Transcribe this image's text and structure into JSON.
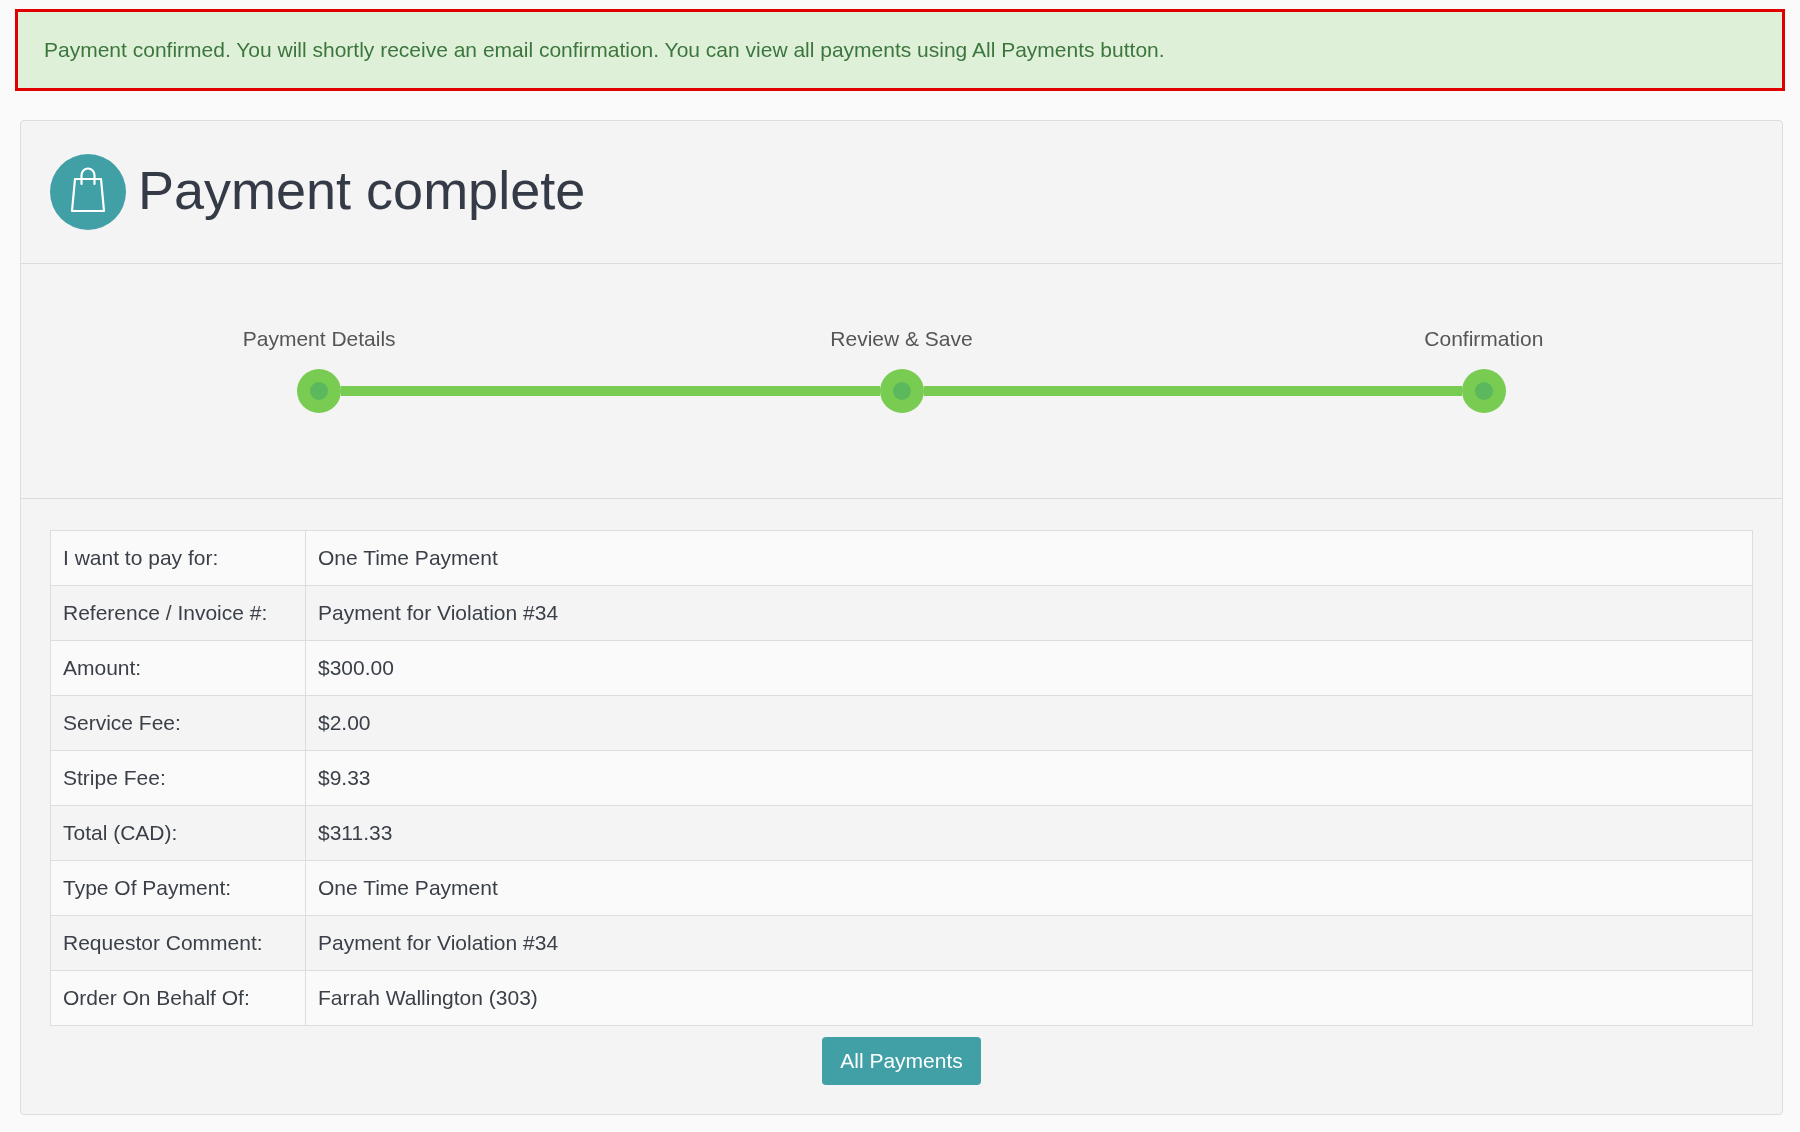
{
  "alert": {
    "message": "Payment confirmed. You will shortly receive an email confirmation. You can view all payments using All Payments button.",
    "highlighted": true
  },
  "header": {
    "title": "Payment complete"
  },
  "steps": [
    {
      "label": "Payment Details",
      "completed": true
    },
    {
      "label": "Review & Save",
      "completed": true
    },
    {
      "label": "Confirmation",
      "completed": true
    }
  ],
  "details": [
    {
      "label": "I want to pay for:",
      "value": "One Time Payment"
    },
    {
      "label": "Reference / Invoice #:",
      "value": "Payment for Violation #34"
    },
    {
      "label": "Amount:",
      "value": "$300.00"
    },
    {
      "label": "Service Fee:",
      "value": "$2.00"
    },
    {
      "label": "Stripe Fee:",
      "value": "$9.33"
    },
    {
      "label": "Total (CAD):",
      "value": "$311.33"
    },
    {
      "label": "Type Of Payment:",
      "value": "One Time Payment"
    },
    {
      "label": "Requestor Comment:",
      "value": "Payment for Violation #34"
    },
    {
      "label": "Order On Behalf Of:",
      "value": "Farrah Wallington (303)"
    }
  ],
  "buttons": [
    {
      "label": "All Payments"
    }
  ]
}
